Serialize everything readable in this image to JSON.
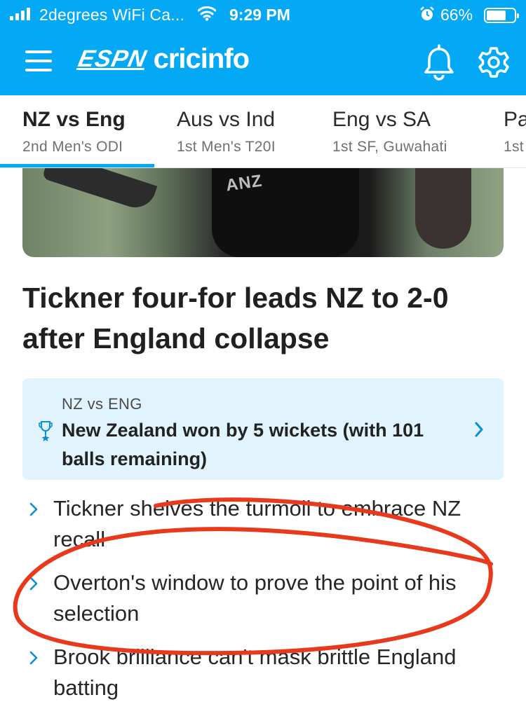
{
  "status_bar": {
    "carrier": "2degrees WiFi Ca...",
    "time": "9:29 PM",
    "battery": "66%",
    "battery_level": 0.66
  },
  "header": {
    "logo_espn": "ESPN",
    "logo_cricinfo": "cricinfo",
    "icons": [
      "menu-icon",
      "bell-icon",
      "gear-icon"
    ],
    "brand_color": "#03a9f4"
  },
  "tabs": [
    {
      "title": "NZ vs Eng",
      "subtitle": "2nd Men's ODI",
      "active": true
    },
    {
      "title": "Aus vs Ind",
      "subtitle": "1st Men's T20I",
      "active": false
    },
    {
      "title": "Eng vs SA",
      "subtitle": "1st SF, Guwahati",
      "active": false
    },
    {
      "title": "Pa",
      "subtitle": "1st",
      "active": false
    }
  ],
  "hero": {
    "jersey_text": "ANZ"
  },
  "article": {
    "headline": "Tickner four-for leads NZ to 2-0 after England collapse"
  },
  "result_card": {
    "match": "NZ vs ENG",
    "result": "New Zealand won by 5 wickets (with 101 balls remaining)",
    "icon": "trophy-icon"
  },
  "related_links": [
    "Tickner shelves the turmoil to embrace NZ recall",
    "Overton's window to prove the point of his selection",
    "Brook brilliance can't mask brittle England batting"
  ],
  "annotation": {
    "color": "#e8391d"
  }
}
